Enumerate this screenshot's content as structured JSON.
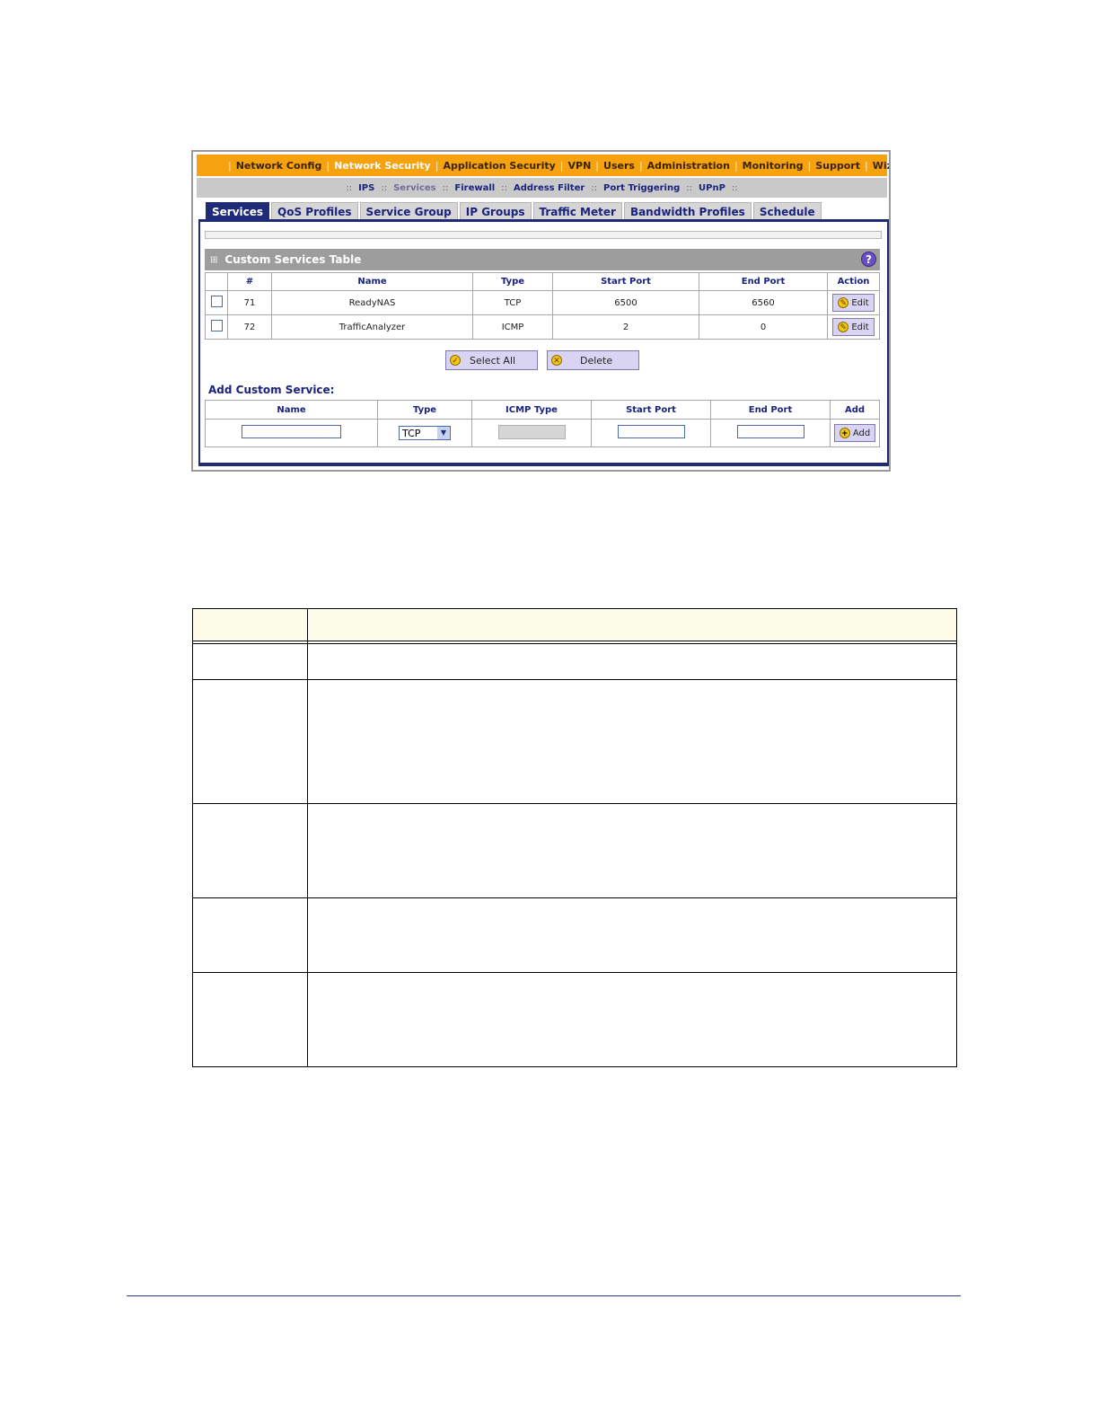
{
  "top_menu": {
    "items": [
      {
        "label": "Network Config",
        "active": false
      },
      {
        "label": "Network Security",
        "active": true
      },
      {
        "label": "Application Security",
        "active": false
      },
      {
        "label": "VPN",
        "active": false
      },
      {
        "label": "Users",
        "active": false
      },
      {
        "label": "Administration",
        "active": false
      },
      {
        "label": "Monitoring",
        "active": false
      },
      {
        "label": "Support",
        "active": false
      },
      {
        "label": "Wizards",
        "active": false
      }
    ],
    "separator": "|"
  },
  "sub_menu": {
    "separator": "::",
    "items": [
      {
        "label": "IPS",
        "active": false
      },
      {
        "label": "Services",
        "active": true
      },
      {
        "label": "Firewall",
        "active": false
      },
      {
        "label": "Address Filter",
        "active": false
      },
      {
        "label": "Port Triggering",
        "active": false
      },
      {
        "label": "UPnP",
        "active": false
      }
    ]
  },
  "tabs": [
    {
      "label": "Services",
      "active": true
    },
    {
      "label": "QoS Profiles",
      "active": false
    },
    {
      "label": "Service Group",
      "active": false
    },
    {
      "label": "IP Groups",
      "active": false
    },
    {
      "label": "Traffic Meter",
      "active": false
    },
    {
      "label": "Bandwidth Profiles",
      "active": false
    },
    {
      "label": "Schedule",
      "active": false
    }
  ],
  "custom_services": {
    "title": "Custom Services Table",
    "help": "?",
    "grid_glyph": "⊞",
    "columns": {
      "num": "#",
      "name": "Name",
      "type": "Type",
      "start_port": "Start Port",
      "end_port": "End Port",
      "action": "Action"
    },
    "rows": [
      {
        "num": "71",
        "name": "ReadyNAS",
        "type": "TCP",
        "start_port": "6500",
        "end_port": "6560",
        "action": "Edit"
      },
      {
        "num": "72",
        "name": "TrafficAnalyzer",
        "type": "ICMP",
        "start_port": "2",
        "end_port": "0",
        "action": "Edit"
      }
    ],
    "select_all_label": "Select All",
    "delete_label": "Delete"
  },
  "add_service": {
    "title": "Add Custom Service:",
    "columns": {
      "name": "Name",
      "type": "Type",
      "icmp_type": "ICMP Type",
      "start_port": "Start Port",
      "end_port": "End Port",
      "add": "Add"
    },
    "type_value": "TCP",
    "add_label": "Add"
  },
  "colors": {
    "menu_orange": "#f6a10f",
    "navy": "#1f2a78",
    "submenu_gray": "#c9c9c9",
    "header_gray": "#9d9d9d",
    "button_lavender": "#d9d4f2",
    "desc_header": "#fefde8",
    "footer_rule": "#2b3a8c"
  }
}
